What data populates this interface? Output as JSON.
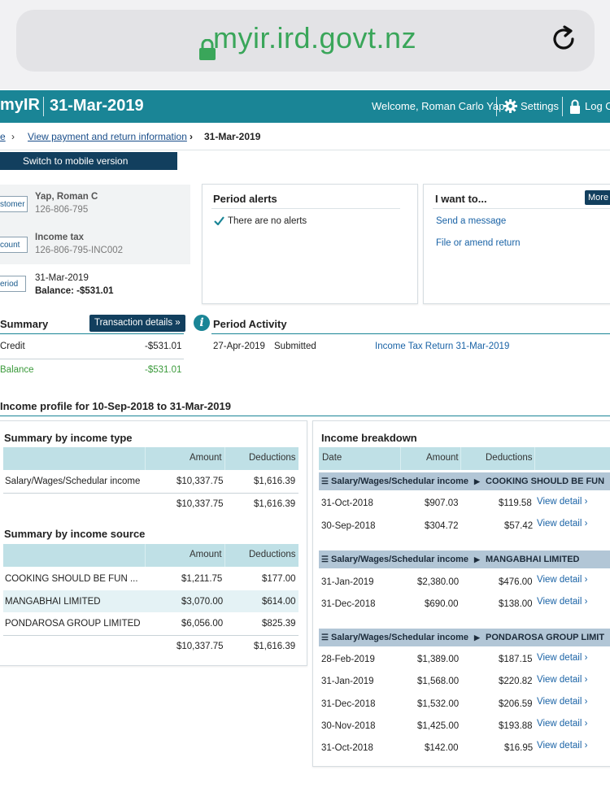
{
  "browser": {
    "url": "myir.ird.govt.nz"
  },
  "header": {
    "logo": "myIR",
    "period": "31-Mar-2019",
    "welcome": "Welcome, Roman Carlo Yap",
    "settings": "Settings",
    "logout": "Log O"
  },
  "breadcrumb": {
    "home": "e",
    "view": "View payment and return information",
    "current": "31-Mar-2019"
  },
  "mobile_button": "Switch to mobile version",
  "info": {
    "customer_tag": "stomer",
    "customer_name": "Yap, Roman C",
    "customer_id": "126-806-795",
    "account_tag": "count",
    "account_type": "Income tax",
    "account_id": "126-806-795-INC002",
    "period_tag": "eriod",
    "period_date": "31-Mar-2019",
    "balance": "Balance: -$531.01"
  },
  "alerts": {
    "title": "Period alerts",
    "text": "There are no alerts"
  },
  "iwant": {
    "title": "I want to...",
    "more": "More",
    "links": [
      "Send a message",
      "File or amend return"
    ]
  },
  "summary": {
    "title": "Summary",
    "button": "Transaction details »",
    "rows": [
      {
        "label": "Credit",
        "value": "-$531.01"
      },
      {
        "label": "Balance",
        "value": "-$531.01"
      }
    ],
    "balance_color": "#3b9a3b"
  },
  "activity": {
    "title": "Period Activity",
    "date": "27-Apr-2019",
    "status": "Submitted",
    "link": "Income Tax Return 31-Mar-2019"
  },
  "profile": {
    "title": "Income profile for 10-Sep-2018 to 31-Mar-2019",
    "by_type": {
      "title": "Summary by income type",
      "headers": [
        "Amount",
        "Deductions"
      ],
      "rows": [
        {
          "name": "Salary/Wages/Schedular income",
          "amount": "$10,337.75",
          "deductions": "$1,616.39"
        }
      ],
      "total": {
        "amount": "$10,337.75",
        "deductions": "$1,616.39"
      }
    },
    "by_source": {
      "title": "Summary by income source",
      "headers": [
        "Amount",
        "Deductions"
      ],
      "rows": [
        {
          "name": "COOKING SHOULD BE FUN ...",
          "amount": "$1,211.75",
          "deductions": "$177.00"
        },
        {
          "name": "MANGABHAI LIMITED",
          "amount": "$3,070.00",
          "deductions": "$614.00"
        },
        {
          "name": "PONDAROSA GROUP LIMITED",
          "amount": "$6,056.00",
          "deductions": "$825.39"
        }
      ],
      "total": {
        "amount": "$10,337.75",
        "deductions": "$1,616.39"
      }
    },
    "breakdown": {
      "title": "Income breakdown",
      "headers": [
        "Date",
        "Amount",
        "Deductions"
      ],
      "view_detail": "View detail",
      "groups": [
        {
          "type": "Salary/Wages/Schedular income",
          "source": "COOKING SHOULD BE FUN",
          "rows": [
            {
              "date": "31-Oct-2018",
              "amount": "$907.03",
              "deductions": "$119.58"
            },
            {
              "date": "30-Sep-2018",
              "amount": "$304.72",
              "deductions": "$57.42"
            }
          ]
        },
        {
          "type": "Salary/Wages/Schedular income",
          "source": "MANGABHAI LIMITED",
          "rows": [
            {
              "date": "31-Jan-2019",
              "amount": "$2,380.00",
              "deductions": "$476.00"
            },
            {
              "date": "31-Dec-2018",
              "amount": "$690.00",
              "deductions": "$138.00"
            }
          ]
        },
        {
          "type": "Salary/Wages/Schedular income",
          "source": "PONDAROSA GROUP LIMIT",
          "rows": [
            {
              "date": "28-Feb-2019",
              "amount": "$1,389.00",
              "deductions": "$187.15"
            },
            {
              "date": "31-Jan-2019",
              "amount": "$1,568.00",
              "deductions": "$220.82"
            },
            {
              "date": "31-Dec-2018",
              "amount": "$1,532.00",
              "deductions": "$206.59"
            },
            {
              "date": "30-Nov-2018",
              "amount": "$1,425.00",
              "deductions": "$193.88"
            },
            {
              "date": "31-Oct-2018",
              "amount": "$142.00",
              "deductions": "$16.95"
            }
          ]
        }
      ]
    }
  },
  "colors": {
    "header": "#1a8596",
    "dark_button": "#123f5e",
    "table_head": "#bfe0e6",
    "group_bar": "#b2c6d6",
    "link": "#1a63a6",
    "url_green": "#3aa65a"
  }
}
